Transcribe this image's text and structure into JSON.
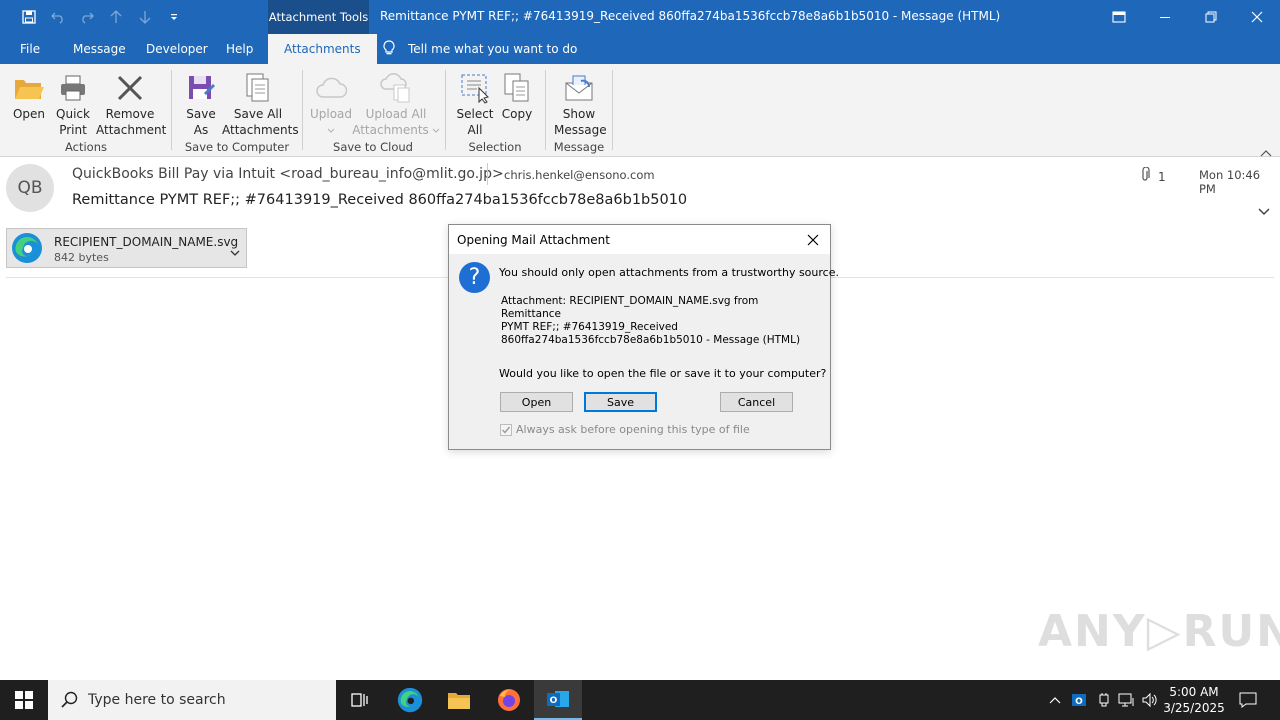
{
  "titlebar": {
    "contextual_tab": "Attachment Tools",
    "title": "Remittance PYMT REF;; #76413919_Received 860ffa274ba1536fccb78e8a6b1b5010  -  Message (HTML)"
  },
  "tabs": [
    {
      "label": "File"
    },
    {
      "label": "Message"
    },
    {
      "label": "Developer"
    },
    {
      "label": "Help"
    },
    {
      "label": "Attachments"
    }
  ],
  "tell_me": "Tell me what you want to do",
  "ribbon": {
    "buttons": {
      "open": "Open",
      "quick_print_1": "Quick",
      "quick_print_2": "Print",
      "remove_1": "Remove",
      "remove_2": "Attachment",
      "save_as_1": "Save",
      "save_as_2": "As",
      "save_all_1": "Save All",
      "save_all_2": "Attachments",
      "upload": "Upload",
      "upload_all_1": "Upload All",
      "upload_all_2": "Attachments",
      "select_all_1": "Select",
      "select_all_2": "All",
      "copy": "Copy",
      "show_message_1": "Show",
      "show_message_2": "Message"
    },
    "groups": {
      "actions": "Actions",
      "save_to_computer": "Save to Computer",
      "save_to_cloud": "Save to Cloud",
      "selection": "Selection",
      "message": "Message"
    }
  },
  "message": {
    "avatar_initials": "QB",
    "from": "QuickBooks Bill Pay via Intuit <road_bureau_info@mlit.go.jp>",
    "to": "chris.henkel@ensono.com",
    "attachment_count": "1",
    "date": "Mon 10:46 PM",
    "subject": "Remittance PYMT REF;; #76413919_Received 860ffa274ba1536fccb78e8a6b1b5010"
  },
  "attachment": {
    "name": "RECIPIENT_DOMAIN_NAME.svg",
    "size": "842 bytes"
  },
  "dialog": {
    "title": "Opening Mail Attachment",
    "warning": "You should only open attachments from a trustworthy source.",
    "info_line1": "Attachment: RECIPIENT_DOMAIN_NAME.svg from Remittance",
    "info_line2": "PYMT REF;; #76413919_Received",
    "info_line3": "860ffa274ba1536fccb78e8a6b1b5010 - Message (HTML)",
    "question": "Would you like to open the file or save it to your computer?",
    "open_button": "Open",
    "save_button": "Save",
    "cancel_button": "Cancel",
    "checkbox_label": "Always ask before opening this type of file",
    "checkbox_checked": true
  },
  "watermark": "ANY RUN",
  "taskbar": {
    "search_placeholder": "Type here to search",
    "time": "5:00 AM",
    "date": "3/25/2025"
  },
  "colors": {
    "titlebar": "#1e67b9",
    "ribbon": "#f3f3f3",
    "taskbar": "#1f1f1f",
    "accent": "#0078d7"
  }
}
